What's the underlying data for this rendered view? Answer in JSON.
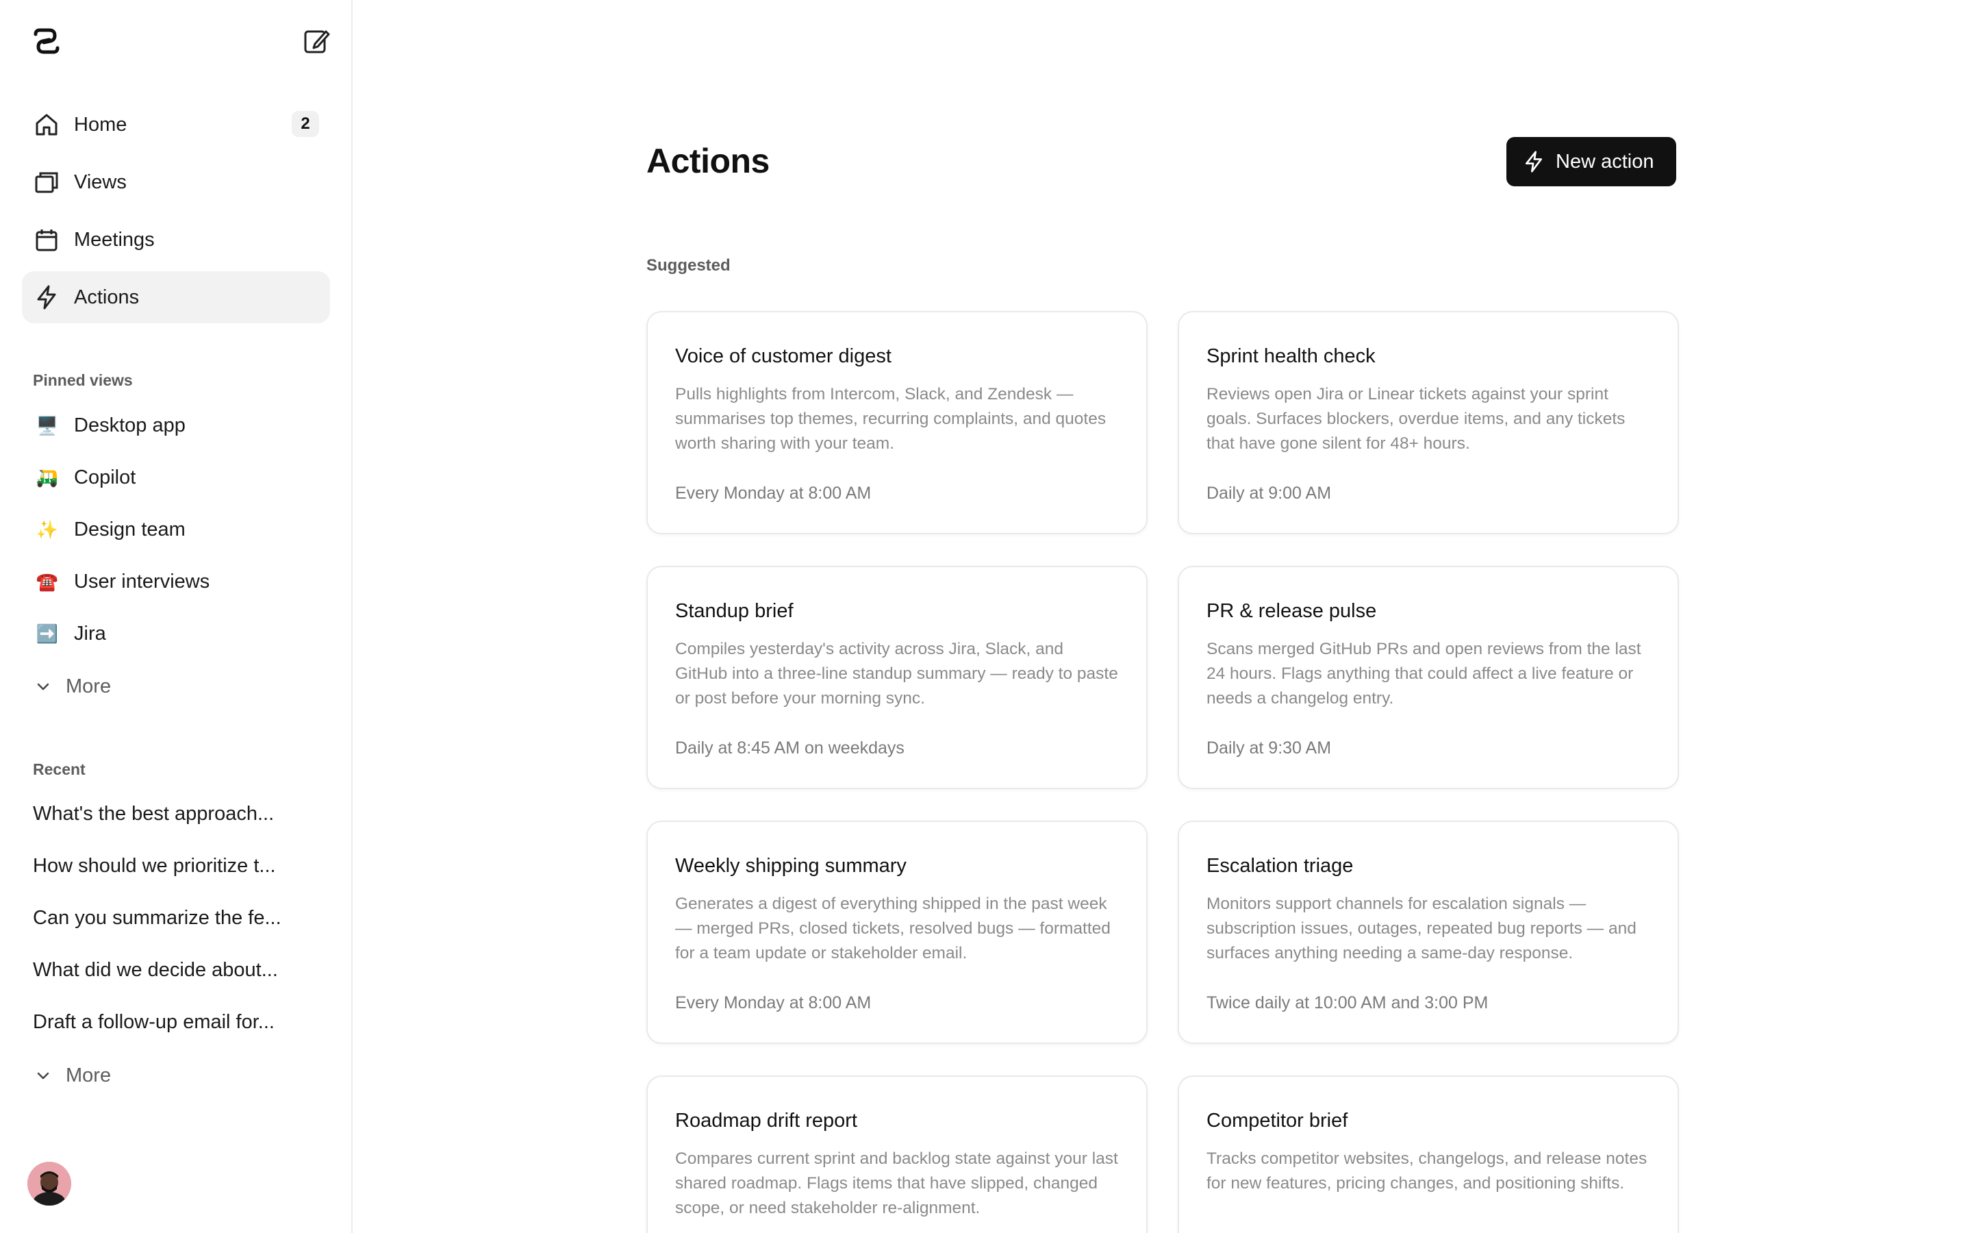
{
  "sidebar": {
    "nav": [
      {
        "label": "Home",
        "icon": "home-icon",
        "badge": "2"
      },
      {
        "label": "Views",
        "icon": "views-icon"
      },
      {
        "label": "Meetings",
        "icon": "calendar-icon"
      },
      {
        "label": "Actions",
        "icon": "lightning-icon",
        "active": true
      }
    ],
    "pinned_label": "Pinned views",
    "pinned": [
      {
        "emoji": "🖥️",
        "label": "Desktop app"
      },
      {
        "emoji": "🛺",
        "label": "Copilot"
      },
      {
        "emoji": "✨",
        "label": "Design team"
      },
      {
        "emoji": "☎️",
        "label": "User interviews"
      },
      {
        "emoji": "➡️",
        "label": "Jira"
      }
    ],
    "pinned_more": "More",
    "recent_label": "Recent",
    "recent": [
      "What's the best approach...",
      "How should we prioritize t...",
      "Can you summarize the fe...",
      "What did we decide about...",
      "Draft a follow-up email for..."
    ],
    "recent_more": "More"
  },
  "main": {
    "title": "Actions",
    "new_action_label": "New action",
    "suggested_label": "Suggested",
    "cards": [
      {
        "title": "Voice of customer digest",
        "description": "Pulls highlights from Intercom, Slack, and Zendesk — summarises top themes, recurring complaints, and quotes worth sharing with your team.",
        "schedule": "Every Monday at 8:00 AM"
      },
      {
        "title": "Sprint health check",
        "description": "Reviews open Jira or Linear tickets against your sprint goals. Surfaces blockers, overdue items, and any tickets that have gone silent for 48+ hours.",
        "schedule": "Daily at 9:00 AM"
      },
      {
        "title": "Standup brief",
        "description": "Compiles yesterday's activity across Jira, Slack, and GitHub into a three-line standup summary — ready to paste or post before your morning sync.",
        "schedule": "Daily at 8:45 AM on weekdays"
      },
      {
        "title": "PR & release pulse",
        "description": "Scans merged GitHub PRs and open reviews from the last 24 hours. Flags anything that could affect a live feature or needs a changelog entry.",
        "schedule": "Daily at 9:30 AM"
      },
      {
        "title": "Weekly shipping summary",
        "description": "Generates a digest of everything shipped in the past week — merged PRs, closed tickets, resolved bugs — formatted for a team update or stakeholder email.",
        "schedule": "Every Monday at 8:00 AM"
      },
      {
        "title": "Escalation triage",
        "description": "Monitors support channels for escalation signals — subscription issues, outages, repeated bug reports — and surfaces anything needing a same-day response.",
        "schedule": "Twice daily at 10:00 AM and 3:00 PM"
      },
      {
        "title": "Roadmap drift report",
        "description": "Compares current sprint and backlog state against your last shared roadmap. Flags items that have slipped, changed scope, or need stakeholder re-alignment.",
        "schedule": ""
      },
      {
        "title": "Competitor brief",
        "description": "Tracks competitor websites, changelogs, and release notes for new features, pricing changes, and positioning shifts.",
        "schedule": ""
      }
    ]
  }
}
